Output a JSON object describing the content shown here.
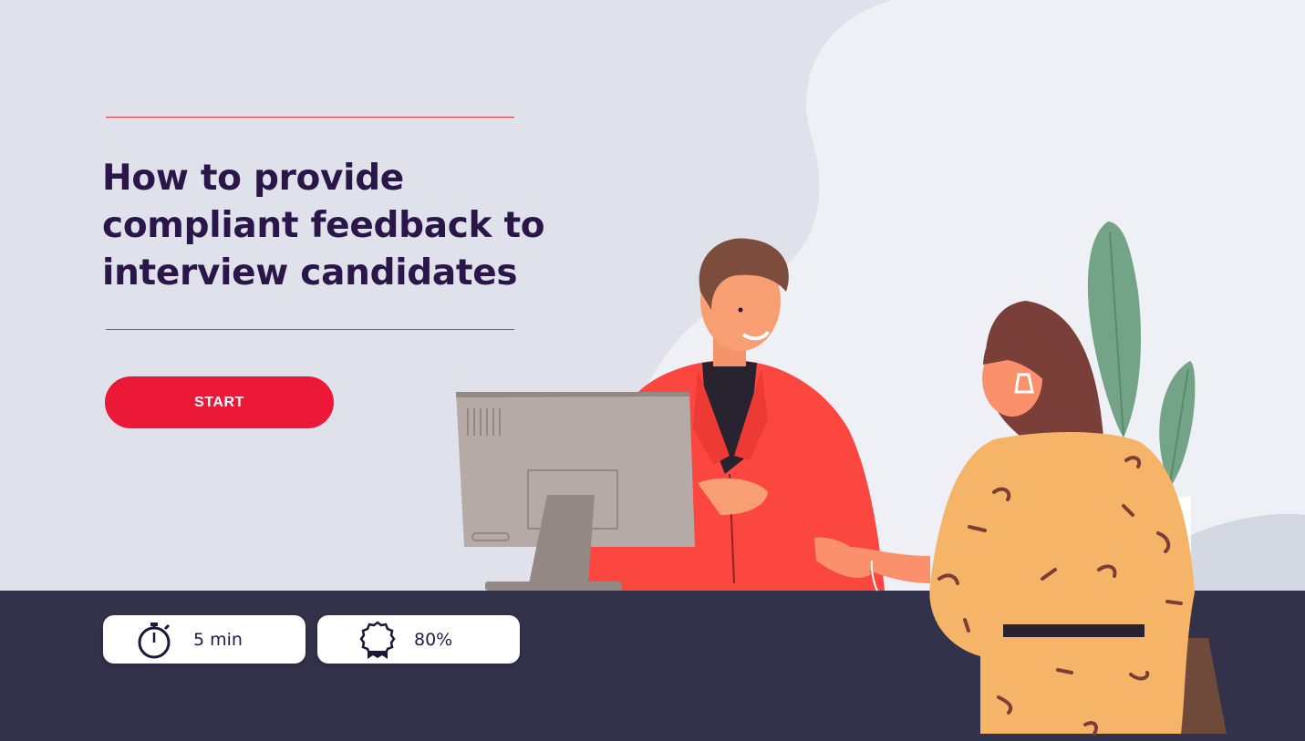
{
  "course": {
    "title": "How to provide compliant feedback to interview candidates",
    "start_label": "START"
  },
  "meta": {
    "duration": {
      "icon": "stopwatch-icon",
      "value": "5 min"
    },
    "pass_score": {
      "icon": "award-ribbon-icon",
      "value": "80%"
    }
  },
  "colors": {
    "background": "#dfe2ea",
    "accent": "#ec1837",
    "title_text": "#2a1648",
    "footer_band": "#33324b"
  },
  "illustration": {
    "name": "recruiter-and-candidate-illustration"
  }
}
